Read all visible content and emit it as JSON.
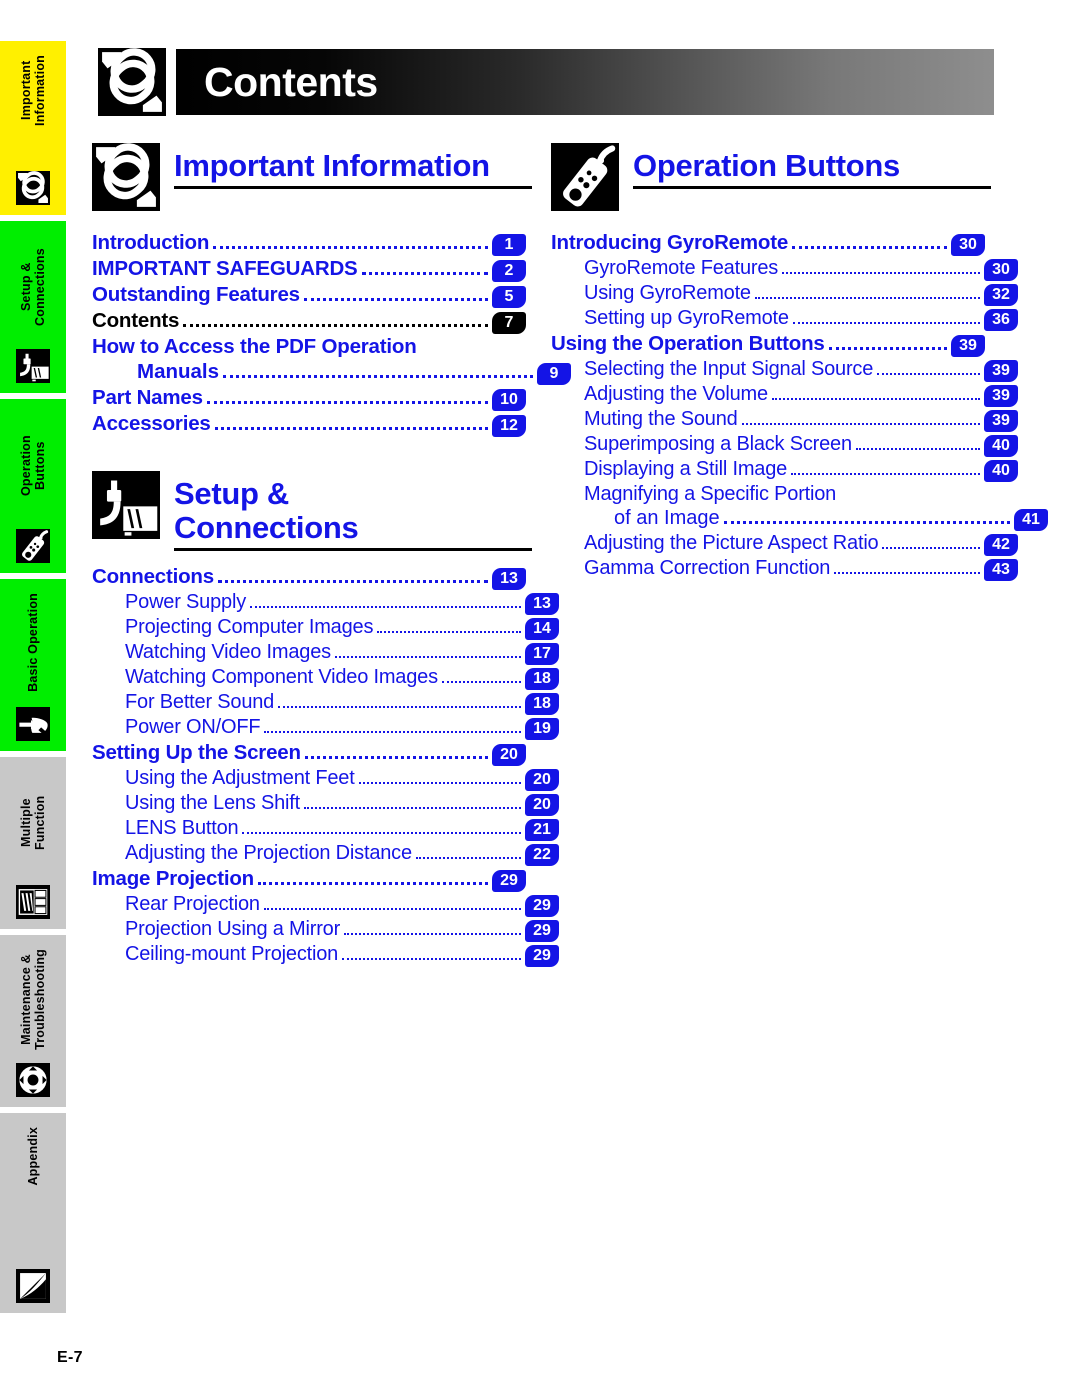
{
  "page": {
    "header_title": "Contents",
    "footer_label": "E-7",
    "accent_blue": "#1414E6",
    "header_gradient_from": "#000000",
    "header_gradient_to": "#8E8E8E"
  },
  "side_rail": {
    "tabs": [
      {
        "label": "Important\nInformation",
        "color": "#FFF000",
        "icon": "paperclip-icon"
      },
      {
        "label": "Setup & Connections",
        "color": "#00EE00",
        "icon": "plug-projector-icon"
      },
      {
        "label": "Operation Buttons",
        "color": "#00EE00",
        "icon": "remote-control-icon"
      },
      {
        "label": "Basic Operation",
        "color": "#00EE00",
        "icon": "hand-pointer-icon"
      },
      {
        "label": "Multiple Function",
        "color": "#C8C8C8",
        "icon": "multi-window-icon"
      },
      {
        "label": "Maintenance &\nTroubleshooting",
        "color": "#C8C8C8",
        "icon": "life-ring-icon"
      },
      {
        "label": "Appendix",
        "color": "#C8C8C8",
        "icon": "appendix-square-icon"
      }
    ]
  },
  "columns": {
    "left": [
      {
        "title": "Important Information",
        "icon": "paperclip-icon",
        "entries": [
          {
            "level": 1,
            "text": "Introduction",
            "page": "1"
          },
          {
            "level": 1,
            "text": "IMPORTANT SAFEGUARDS",
            "page": "2"
          },
          {
            "level": 1,
            "text": "Outstanding Features",
            "page": "5"
          },
          {
            "level": 1,
            "text": "Contents",
            "page": "7",
            "current": true
          },
          {
            "level": 1,
            "text": "How to Access the PDF Operation",
            "page": "",
            "no_leader": true,
            "no_badge": true
          },
          {
            "level": "1w",
            "text": "Manuals",
            "page": "9"
          },
          {
            "level": 1,
            "text": "Part Names",
            "page": "10"
          },
          {
            "level": 1,
            "text": "Accessories",
            "page": "12"
          }
        ]
      },
      {
        "title": "Setup &\nConnections",
        "icon": "plug-projector-icon",
        "entries": [
          {
            "level": 1,
            "text": "Connections",
            "page": "13"
          },
          {
            "level": 2,
            "text": "Power Supply",
            "page": "13"
          },
          {
            "level": 2,
            "text": "Projecting Computer Images",
            "page": "14"
          },
          {
            "level": 2,
            "text": "Watching Video Images",
            "page": "17"
          },
          {
            "level": 2,
            "text": "Watching Component Video Images",
            "page": "18"
          },
          {
            "level": 2,
            "text": "For Better Sound",
            "page": "18"
          },
          {
            "level": 2,
            "text": "Power ON/OFF",
            "page": "19"
          },
          {
            "level": 1,
            "text": "Setting Up the Screen",
            "page": "20"
          },
          {
            "level": 2,
            "text": "Using the Adjustment Feet",
            "page": "20"
          },
          {
            "level": 2,
            "text": "Using the Lens Shift",
            "page": "20"
          },
          {
            "level": 2,
            "text": "LENS Button",
            "page": "21"
          },
          {
            "level": 2,
            "text": "Adjusting the Projection Distance",
            "page": "22"
          },
          {
            "level": 1,
            "text": "Image Projection",
            "page": "29"
          },
          {
            "level": 2,
            "text": "Rear Projection",
            "page": "29"
          },
          {
            "level": 2,
            "text": "Projection Using a Mirror",
            "page": "29"
          },
          {
            "level": 2,
            "text": "Ceiling-mount Projection",
            "page": "29"
          }
        ]
      }
    ],
    "right": [
      {
        "title": "Operation Buttons",
        "icon": "remote-control-icon",
        "entries": [
          {
            "level": 1,
            "text": "Introducing GyroRemote",
            "page": "30"
          },
          {
            "level": 2,
            "text": "GyroRemote Features",
            "page": "30"
          },
          {
            "level": 2,
            "text": "Using GyroRemote",
            "page": "32"
          },
          {
            "level": 2,
            "text": "Setting up GyroRemote",
            "page": "36"
          },
          {
            "level": 1,
            "text": "Using the Operation Buttons",
            "page": "39"
          },
          {
            "level": 2,
            "text": "Selecting the Input Signal Source",
            "page": "39"
          },
          {
            "level": 2,
            "text": "Adjusting the Volume",
            "page": "39"
          },
          {
            "level": 2,
            "text": "Muting the Sound",
            "page": "39"
          },
          {
            "level": 2,
            "text": "Superimposing a Black Screen",
            "page": "40"
          },
          {
            "level": 2,
            "text": "Displaying a Still Image",
            "page": "40"
          },
          {
            "level": 2,
            "text": "Magnifying a Specific Portion",
            "page": "",
            "no_leader": true,
            "no_badge": true
          },
          {
            "level": "2w",
            "text": "of an Image",
            "page": "41"
          },
          {
            "level": 2,
            "text": "Adjusting the Picture Aspect Ratio",
            "page": "42"
          },
          {
            "level": 2,
            "text": "Gamma Correction Function",
            "page": "43"
          }
        ]
      }
    ]
  }
}
